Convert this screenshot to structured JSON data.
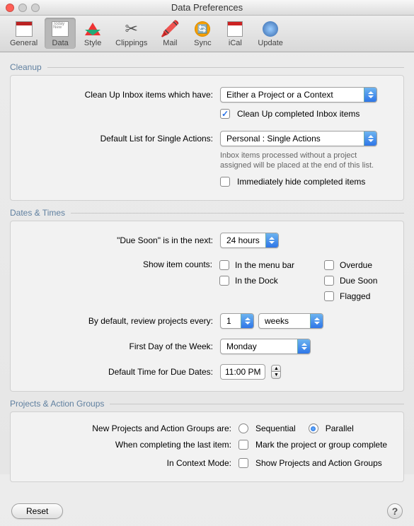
{
  "window": {
    "title": "Data Preferences"
  },
  "toolbar": [
    {
      "id": "general",
      "label": "General",
      "selected": false
    },
    {
      "id": "data",
      "label": "Data",
      "selected": true
    },
    {
      "id": "style",
      "label": "Style",
      "selected": false
    },
    {
      "id": "clippings",
      "label": "Clippings",
      "selected": false
    },
    {
      "id": "mail",
      "label": "Mail",
      "selected": false
    },
    {
      "id": "sync",
      "label": "Sync",
      "selected": false
    },
    {
      "id": "ical",
      "label": "iCal",
      "selected": false
    },
    {
      "id": "update",
      "label": "Update",
      "selected": false
    }
  ],
  "cleanup": {
    "title": "Cleanup",
    "cleanup_label": "Clean Up Inbox items which have:",
    "cleanup_value": "Either a Project or a Context",
    "cleanup_completed_checked": true,
    "cleanup_completed_label": "Clean Up completed Inbox items",
    "default_list_label": "Default List for Single Actions:",
    "default_list_value": "Personal : Single Actions",
    "default_list_hint": "Inbox items processed without a project assigned will be placed at the end of this list.",
    "immediately_hide_checked": false,
    "immediately_hide_label": "Immediately hide completed items"
  },
  "dates": {
    "title": "Dates & Times",
    "due_soon_label": "\"Due Soon\" is in the next:",
    "due_soon_value": "24 hours",
    "show_counts_label": "Show item counts:",
    "counts": {
      "menu_bar": {
        "checked": false,
        "label": "In the menu bar"
      },
      "dock": {
        "checked": false,
        "label": "In the Dock"
      },
      "overdue": {
        "checked": false,
        "label": "Overdue"
      },
      "due_soon": {
        "checked": false,
        "label": "Due Soon"
      },
      "flagged": {
        "checked": false,
        "label": "Flagged"
      }
    },
    "review_label": "By default, review projects every:",
    "review_number": "1",
    "review_unit": "weeks",
    "first_day_label": "First Day of the Week:",
    "first_day_value": "Monday",
    "default_time_label": "Default Time for Due Dates:",
    "default_time_value": "11:00 PM"
  },
  "projects": {
    "title": "Projects & Action Groups",
    "type_label": "New Projects and Action Groups are:",
    "type_value": "Parallel",
    "sequential_label": "Sequential",
    "parallel_label": "Parallel",
    "completing_label": "When completing the last item:",
    "completing_checked": false,
    "completing_text": "Mark the project or group complete",
    "context_label": "In Context Mode:",
    "context_checked": false,
    "context_text": "Show Projects and Action Groups"
  },
  "footer": {
    "reset": "Reset",
    "help": "?"
  }
}
